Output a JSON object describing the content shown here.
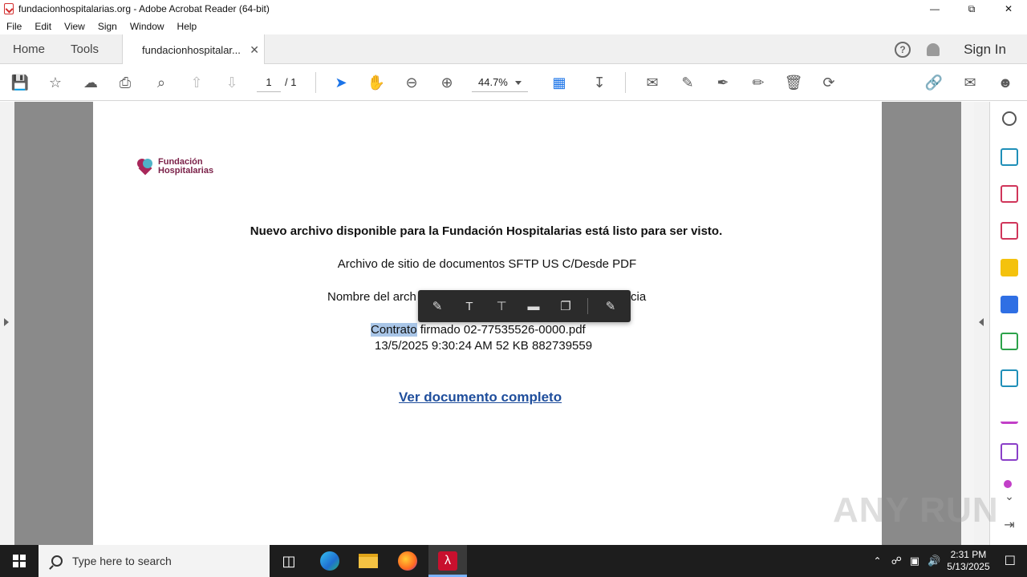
{
  "window": {
    "title": "fundacionhospitalarias.org - Adobe Acrobat Reader (64-bit)",
    "controls": [
      "minimize",
      "restore",
      "close"
    ]
  },
  "menu": [
    "File",
    "Edit",
    "View",
    "Sign",
    "Window",
    "Help"
  ],
  "tabs": {
    "home": "Home",
    "tools": "Tools",
    "document": "fundacionhospitalar...",
    "sign_in": "Sign In"
  },
  "toolbar": {
    "page_current": "1",
    "page_total": "/ 1",
    "zoom": "44.7%"
  },
  "document": {
    "logo": {
      "line1": "Fundación",
      "line2": "Hospitalarias"
    },
    "heading": "Nuevo archivo disponible para la Fundación Hospitalarias está listo para ser visto.",
    "site_line": "Archivo de sitio de documentos SFTP US C/Desde PDF",
    "name_line_left": "Nombre del arch",
    "name_line_right": "cia",
    "file_selected": "Contrato",
    "file_rest": " firmado 02-77535526-0000.pdf",
    "meta": "13/5/2025 9:30:24 AM 52 KB 882739559",
    "link": "Ver documento completo "
  },
  "watermark": "ANY RUN",
  "taskbar": {
    "search_placeholder": "Type here to search",
    "time": "2:31 PM",
    "date": "5/13/2025"
  }
}
